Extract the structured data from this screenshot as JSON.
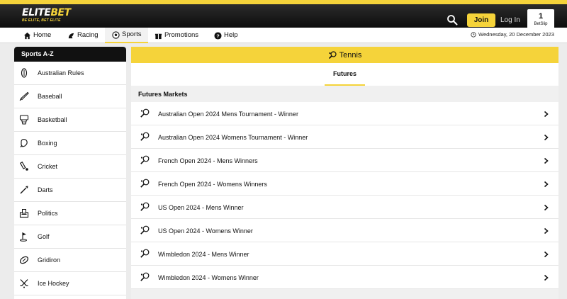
{
  "brand": {
    "logo_text": "ELITEBET",
    "logo_text_main": "ELITE",
    "logo_text_accent": "BET",
    "tagline": "BE ELITE, BET ELITE",
    "accent_color": "#f5d33a"
  },
  "header": {
    "join_label": "Join",
    "login_label": "Log In",
    "betslip_count": "1",
    "betslip_label": "BetSlip"
  },
  "nav": {
    "items": [
      {
        "label": "Home",
        "icon": "home-icon"
      },
      {
        "label": "Racing",
        "icon": "racing-icon"
      },
      {
        "label": "Sports",
        "icon": "soccer-ball-icon",
        "active": true
      },
      {
        "label": "Promotions",
        "icon": "gift-icon"
      },
      {
        "label": "Help",
        "icon": "help-icon"
      }
    ],
    "date": "Wednesday, 20 December 2023"
  },
  "sidebar": {
    "title": "Sports A-Z",
    "items": [
      {
        "label": "Australian Rules",
        "icon": "australian-rules-ball-icon"
      },
      {
        "label": "Baseball",
        "icon": "baseball-bat-icon"
      },
      {
        "label": "Basketball",
        "icon": "basketball-hoop-icon"
      },
      {
        "label": "Boxing",
        "icon": "boxing-glove-icon"
      },
      {
        "label": "Cricket",
        "icon": "cricket-bat-icon"
      },
      {
        "label": "Darts",
        "icon": "dart-icon"
      },
      {
        "label": "Politics",
        "icon": "ballot-box-icon"
      },
      {
        "label": "Golf",
        "icon": "golf-flag-icon"
      },
      {
        "label": "Gridiron",
        "icon": "football-icon"
      },
      {
        "label": "Ice Hockey",
        "icon": "hockey-sticks-icon"
      }
    ]
  },
  "main": {
    "sport_title": "Tennis",
    "tab": "Futures",
    "section_title": "Futures Markets",
    "markets": [
      "Australian Open 2024 Mens Tournament - Winner",
      "Australian Open 2024 Womens Tournament - Winner",
      "French Open 2024 - Mens Winners",
      "French Open 2024 - Womens Winners",
      "US Open 2024 - Mens Winner",
      "US Open 2024 - Womens Winner",
      "Wimbledon 2024 - Mens Winner",
      "Wimbledon 2024 - Womens Winner"
    ]
  }
}
